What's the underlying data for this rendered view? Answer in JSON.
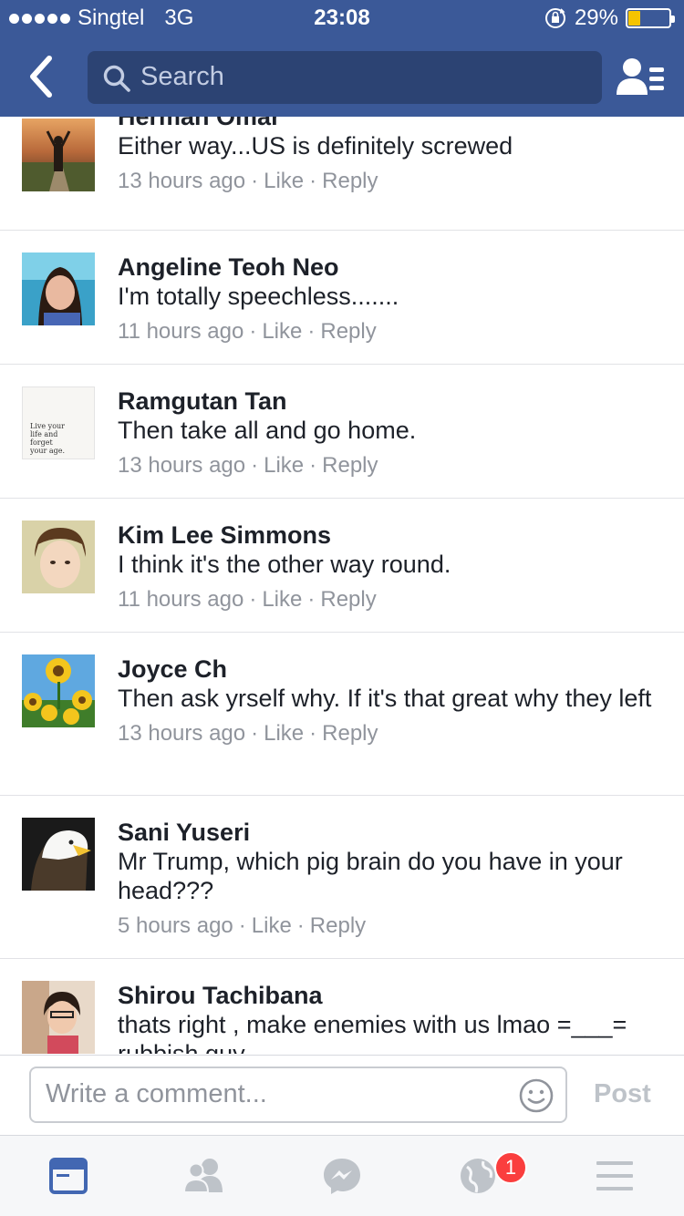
{
  "status_bar": {
    "carrier": "Singtel",
    "network": "3G",
    "time": "23:08",
    "battery": "29%",
    "battery_level": 0.29
  },
  "header": {
    "search_placeholder": "Search"
  },
  "comments": [
    {
      "name": "Herman Omar",
      "text": "Either way...US is definitely screwed",
      "time": "13 hours ago",
      "like": "Like",
      "reply": "Reply"
    },
    {
      "name": "Angeline Teoh Neo",
      "text": "I'm totally speechless.......",
      "time": "11 hours ago",
      "like": "Like",
      "reply": "Reply"
    },
    {
      "name": "Ramgutan Tan",
      "text": "Then take all and go home.",
      "time": "13 hours ago",
      "like": "Like",
      "reply": "Reply",
      "avatar_text": "Live your life and forget your age."
    },
    {
      "name": "Kim Lee Simmons",
      "text": "I think it's the other way round.",
      "time": "11 hours ago",
      "like": "Like",
      "reply": "Reply"
    },
    {
      "name": "Joyce Ch",
      "text": "Then ask yrself why. If it's that great why they left",
      "time": "13 hours ago",
      "like": "Like",
      "reply": "Reply"
    },
    {
      "name": "Sani Yuseri",
      "text": "Mr Trump, which pig brain do you have in your head???",
      "time": "5 hours ago",
      "like": "Like",
      "reply": "Reply"
    },
    {
      "name": "Shirou Tachibana",
      "text": "thats right , make enemies with us lmao =___= rubbish guy",
      "time": "",
      "like": "",
      "reply": ""
    }
  ],
  "composer": {
    "placeholder": "Write a comment...",
    "post_label": "Post"
  },
  "tabbar": {
    "notifications_badge": "1",
    "active_color": "#4267b2",
    "inactive_color": "#bec3c9"
  },
  "colors": {
    "brand": "#3b5998",
    "search_bg": "#2c4373",
    "meta_text": "#90949c",
    "badge": "#fa3e3e"
  }
}
